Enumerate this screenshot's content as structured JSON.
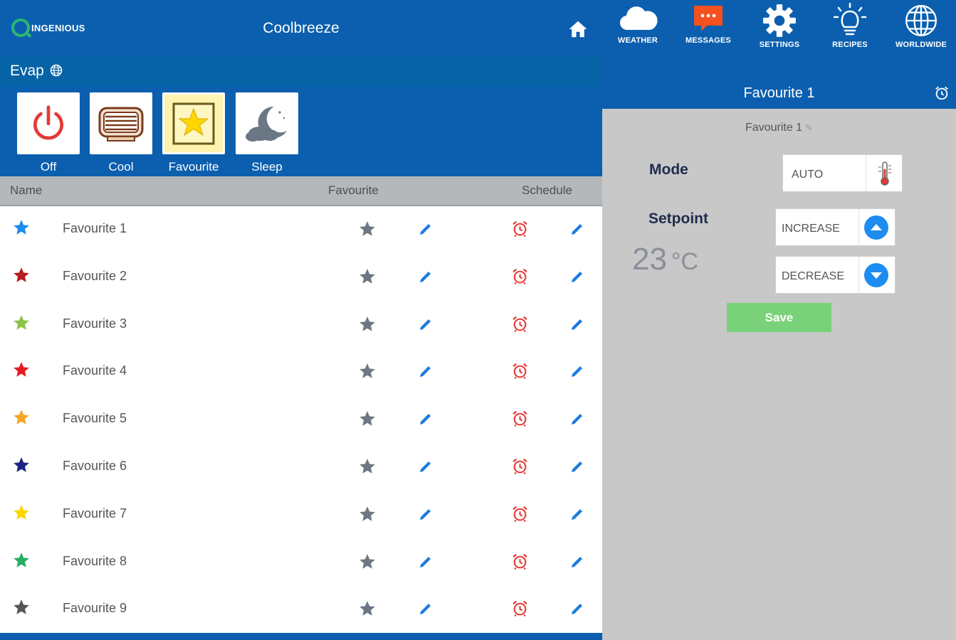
{
  "app": {
    "logo_text": "INGENIOUS",
    "title": "Coolbreeze"
  },
  "device": {
    "name": "Evap"
  },
  "modes": [
    {
      "label": "Off",
      "icon": "power-icon"
    },
    {
      "label": "Cool",
      "icon": "cooler-icon"
    },
    {
      "label": "Favourite",
      "icon": "star-icon",
      "active": true
    },
    {
      "label": "Sleep",
      "icon": "moon-cloud-icon"
    }
  ],
  "list": {
    "headers": {
      "name": "Name",
      "favourite": "Favourite",
      "schedule": "Schedule"
    },
    "rows": [
      {
        "name": "Favourite 1",
        "color": "#1e8cf0"
      },
      {
        "name": "Favourite 2",
        "color": "#b71c1c"
      },
      {
        "name": "Favourite 3",
        "color": "#8bc34a"
      },
      {
        "name": "Favourite 4",
        "color": "#e31b23"
      },
      {
        "name": "Favourite 5",
        "color": "#f5a623"
      },
      {
        "name": "Favourite 6",
        "color": "#1a237e"
      },
      {
        "name": "Favourite 7",
        "color": "#ffd600"
      },
      {
        "name": "Favourite 8",
        "color": "#27ae60"
      },
      {
        "name": "Favourite 9",
        "color": "#555555"
      }
    ]
  },
  "nav": [
    {
      "label": "WEATHER",
      "icon": "cloud-icon"
    },
    {
      "label": "MESSAGES",
      "icon": "message-icon"
    },
    {
      "label": "SETTINGS",
      "icon": "gear-icon"
    },
    {
      "label": "RECIPES",
      "icon": "lightbulb-icon"
    },
    {
      "label": "WORLDWIDE",
      "icon": "globe-icon"
    }
  ],
  "panel": {
    "title": "Favourite 1",
    "favourite_name": "Favourite 1",
    "mode_label": "Mode",
    "mode_value": "AUTO",
    "setpoint_label": "Setpoint",
    "setpoint_value": "23",
    "setpoint_unit": "°C",
    "increase_label": "INCREASE",
    "decrease_label": "DECREASE",
    "save_label": "Save"
  },
  "colors": {
    "primary": "#0b5fae",
    "device_bar": "#0563a6",
    "panel_bg": "#c8c8c8",
    "save": "#79d279",
    "alarm": "#e53935",
    "edit": "#1e7be0",
    "step": "#1e8cf0"
  }
}
